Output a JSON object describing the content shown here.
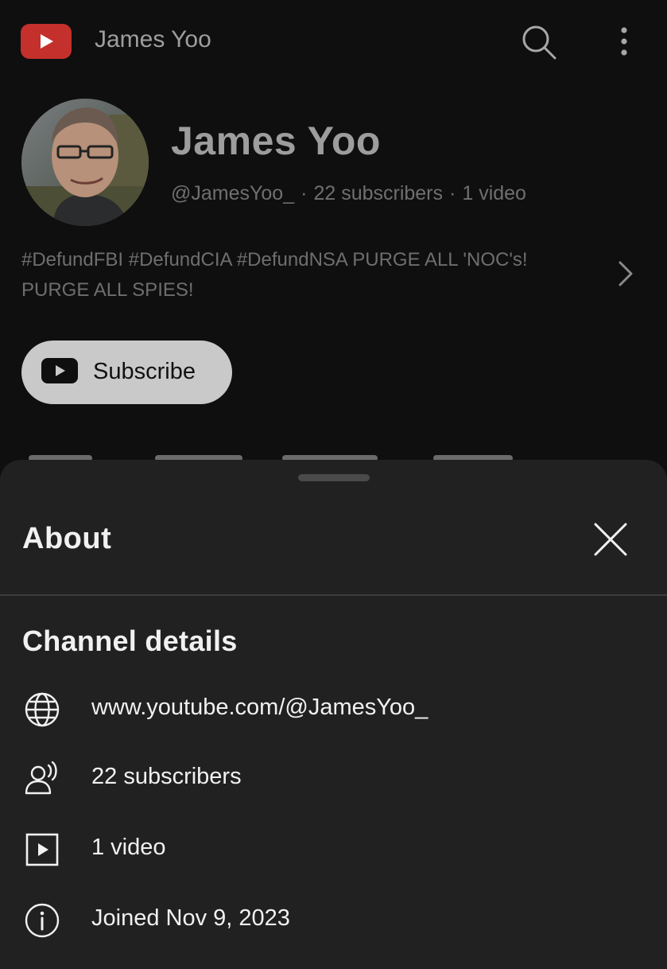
{
  "topbar": {
    "title": "James Yoo",
    "logo_icon": "youtube-logo-icon",
    "search_icon": "search-icon",
    "more_icon": "more-vertical-icon"
  },
  "channel": {
    "name": "James Yoo",
    "handle": "@JamesYoo_",
    "separator": "·",
    "subscribers": "22 subscribers",
    "videos": "1 video",
    "description": "#DefundFBI #DefundCIA #DefundNSA PURGE ALL 'NOC's! PURGE ALL SPIES!",
    "subscribe_label": "Subscribe"
  },
  "about_sheet": {
    "title": "About",
    "section_title": "Channel details",
    "details": [
      {
        "icon": "globe-icon",
        "text": "www.youtube.com/@JamesYoo_"
      },
      {
        "icon": "subscribers-icon",
        "text": "22 subscribers"
      },
      {
        "icon": "video-play-icon",
        "text": "1 video"
      },
      {
        "icon": "info-icon",
        "text": "Joined Nov 9, 2023"
      }
    ]
  },
  "colors": {
    "background": "#0f0f0f",
    "sheet": "#212121",
    "youtube_red": "#c4302b",
    "subscribe_button": "#c9c9c9"
  }
}
